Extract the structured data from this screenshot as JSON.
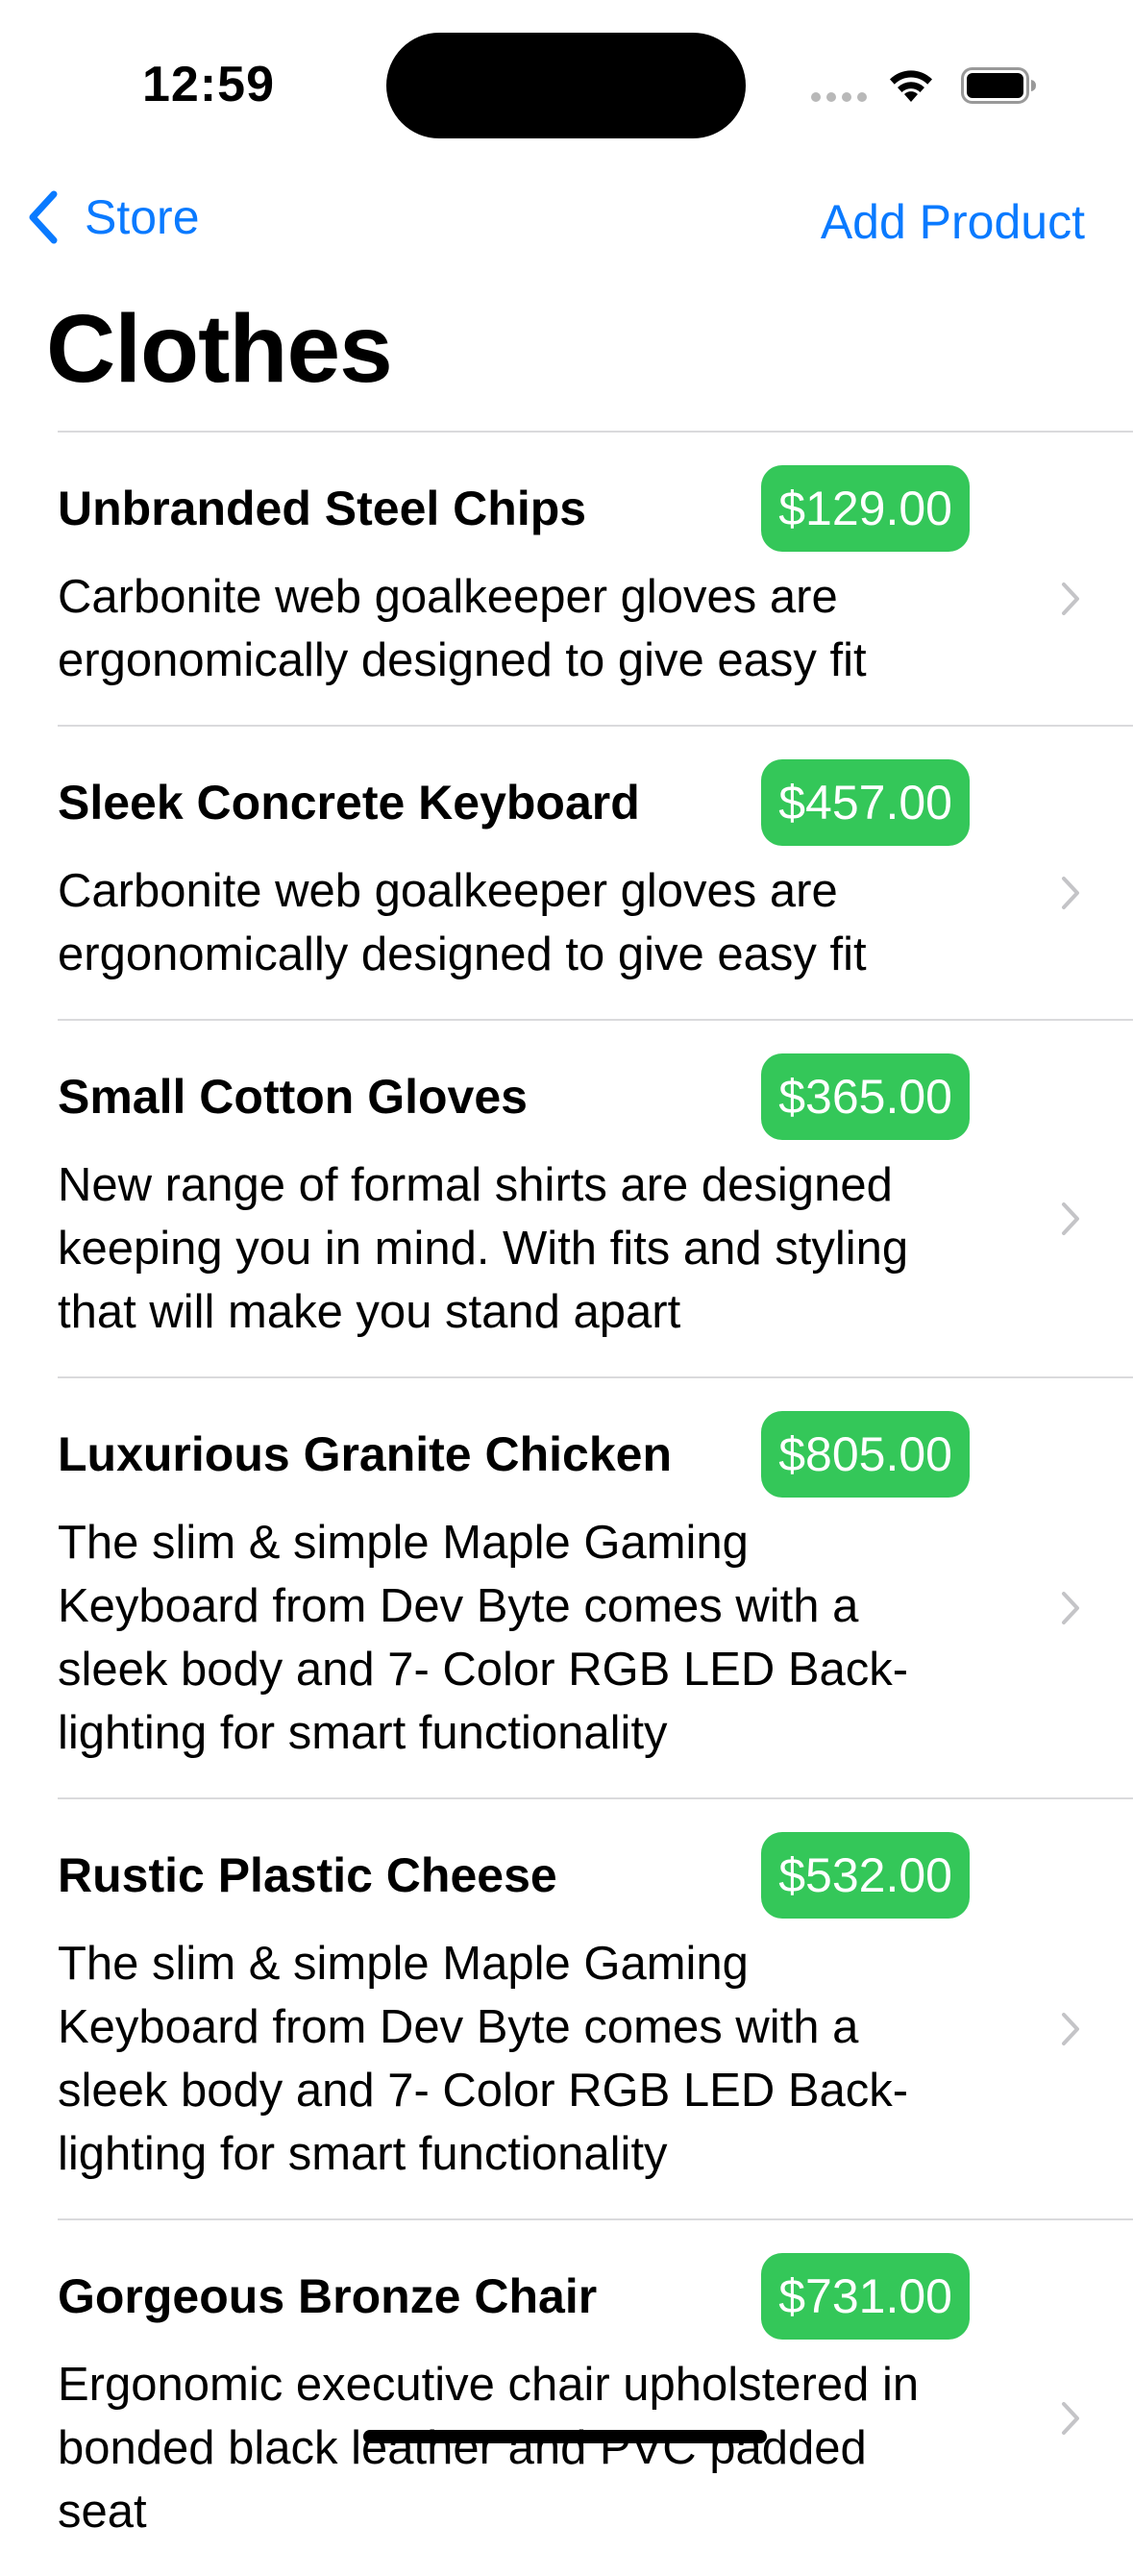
{
  "status_bar": {
    "time": "12:59"
  },
  "nav": {
    "back_label": "Store",
    "action_label": "Add Product"
  },
  "title": "Clothes",
  "products": [
    {
      "name": "Unbranded Steel Chips",
      "price": "$129.00",
      "description": "Carbonite web goalkeeper gloves are ergonomically designed to give easy fit"
    },
    {
      "name": "Sleek Concrete Keyboard",
      "price": "$457.00",
      "description": "Carbonite web goalkeeper gloves are ergonomically designed to give easy fit"
    },
    {
      "name": "Small Cotton Gloves",
      "price": "$365.00",
      "description": "New range of formal shirts are designed keeping you in mind. With fits and styling that will make you stand apart"
    },
    {
      "name": "Luxurious Granite Chicken",
      "price": "$805.00",
      "description": "The slim & simple Maple Gaming Keyboard from Dev Byte comes with a sleek body and 7- Color RGB LED Back-lighting for smart functionality"
    },
    {
      "name": "Rustic Plastic Cheese",
      "price": "$532.00",
      "description": "The slim & simple Maple Gaming Keyboard from Dev Byte comes with a sleek body and 7- Color RGB LED Back-lighting for smart functionality"
    },
    {
      "name": "Gorgeous Bronze Chair",
      "price": "$731.00",
      "description": "Ergonomic executive chair upholstered in bonded black leather and PVC padded seat"
    }
  ],
  "colors": {
    "accent": "#0a7aff",
    "price_badge": "#34c759",
    "separator": "#dadadc"
  },
  "icons": {
    "back": "chevron-left-icon",
    "row_disclosure": "chevron-right-icon",
    "wifi": "wifi-icon",
    "battery": "battery-icon"
  }
}
